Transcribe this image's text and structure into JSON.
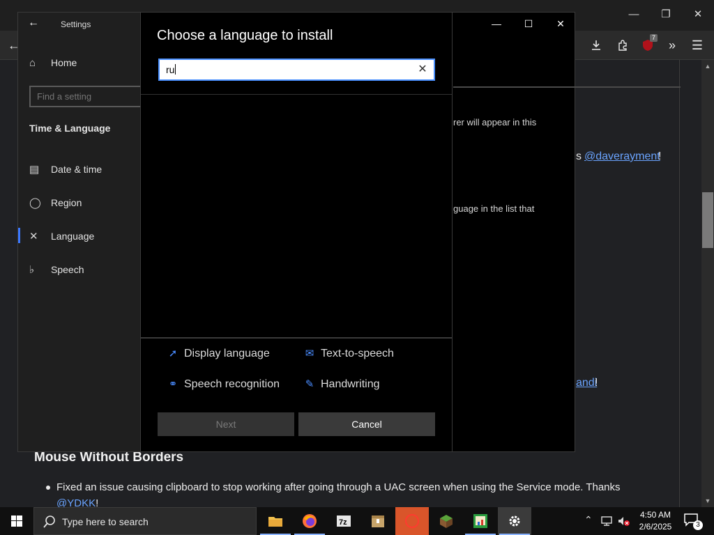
{
  "browser": {
    "page_fragments": {
      "thanks_link": "@daverayment",
      "thanks_prefix": "s",
      "thanks_suffix": "!",
      "link2": "andi",
      "link2_suffix": "!",
      "heading": "Mouse Without Borders",
      "bullet_text": "Fixed an issue causing clipboard to stop working after going through a UAC screen when using the Service mode. Thanks",
      "bullet_link": "@YDKK",
      "bullet_suffix": "!"
    },
    "extension_badge": "7"
  },
  "settings": {
    "title": "Settings",
    "home": "Home",
    "search_placeholder": "Find a setting",
    "section": "Time & Language",
    "nav": [
      {
        "label": "Date & time",
        "icon": "calendar-clock-icon"
      },
      {
        "label": "Region",
        "icon": "globe-icon"
      },
      {
        "label": "Language",
        "icon": "language-icon"
      },
      {
        "label": "Speech",
        "icon": "microphone-icon"
      }
    ],
    "right_fragment_1": "rer will appear in this",
    "right_fragment_2": "guage in the list that"
  },
  "dialog": {
    "title": "Choose a language to install",
    "search_value": "ru",
    "features": [
      {
        "label": "Display language",
        "icon": "display-language-icon"
      },
      {
        "label": "Text-to-speech",
        "icon": "text-to-speech-icon"
      },
      {
        "label": "Speech recognition",
        "icon": "microphone-icon"
      },
      {
        "label": "Handwriting",
        "icon": "handwriting-icon"
      }
    ],
    "next_label": "Next",
    "cancel_label": "Cancel"
  },
  "taskbar": {
    "search_placeholder": "Type here to search",
    "time": "4:50 AM",
    "date": "2/6/2025",
    "notification_count": "3"
  },
  "colors": {
    "accent": "#4a90ff",
    "link": "#6aa4ff"
  }
}
